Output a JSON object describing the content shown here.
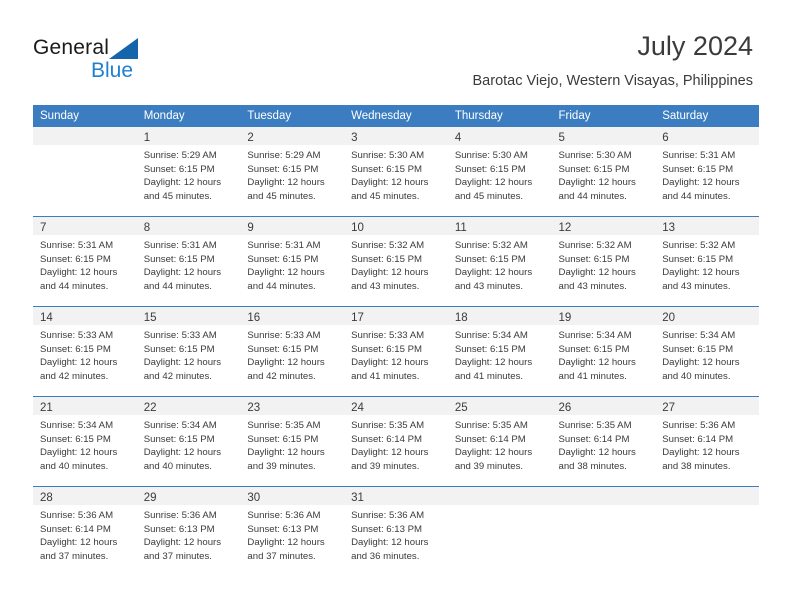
{
  "brand": {
    "name_part1": "General",
    "name_part2": "Blue",
    "accent_color": "#1f7fd0",
    "triangle_color": "#1565ab"
  },
  "header": {
    "title": "July 2024",
    "subtitle": "Barotac Viejo, Western Visayas, Philippines"
  },
  "calendar": {
    "header_bg": "#3b7dc0",
    "daynum_bg": "#f2f2f2",
    "weekday_headers": [
      "Sunday",
      "Monday",
      "Tuesday",
      "Wednesday",
      "Thursday",
      "Friday",
      "Saturday"
    ],
    "weeks": [
      [
        {
          "day": "",
          "sunrise": "",
          "sunset": "",
          "daylight_line1": "",
          "daylight_line2": ""
        },
        {
          "day": "1",
          "sunrise": "Sunrise: 5:29 AM",
          "sunset": "Sunset: 6:15 PM",
          "daylight_line1": "Daylight: 12 hours",
          "daylight_line2": "and 45 minutes."
        },
        {
          "day": "2",
          "sunrise": "Sunrise: 5:29 AM",
          "sunset": "Sunset: 6:15 PM",
          "daylight_line1": "Daylight: 12 hours",
          "daylight_line2": "and 45 minutes."
        },
        {
          "day": "3",
          "sunrise": "Sunrise: 5:30 AM",
          "sunset": "Sunset: 6:15 PM",
          "daylight_line1": "Daylight: 12 hours",
          "daylight_line2": "and 45 minutes."
        },
        {
          "day": "4",
          "sunrise": "Sunrise: 5:30 AM",
          "sunset": "Sunset: 6:15 PM",
          "daylight_line1": "Daylight: 12 hours",
          "daylight_line2": "and 45 minutes."
        },
        {
          "day": "5",
          "sunrise": "Sunrise: 5:30 AM",
          "sunset": "Sunset: 6:15 PM",
          "daylight_line1": "Daylight: 12 hours",
          "daylight_line2": "and 44 minutes."
        },
        {
          "day": "6",
          "sunrise": "Sunrise: 5:31 AM",
          "sunset": "Sunset: 6:15 PM",
          "daylight_line1": "Daylight: 12 hours",
          "daylight_line2": "and 44 minutes."
        }
      ],
      [
        {
          "day": "7",
          "sunrise": "Sunrise: 5:31 AM",
          "sunset": "Sunset: 6:15 PM",
          "daylight_line1": "Daylight: 12 hours",
          "daylight_line2": "and 44 minutes."
        },
        {
          "day": "8",
          "sunrise": "Sunrise: 5:31 AM",
          "sunset": "Sunset: 6:15 PM",
          "daylight_line1": "Daylight: 12 hours",
          "daylight_line2": "and 44 minutes."
        },
        {
          "day": "9",
          "sunrise": "Sunrise: 5:31 AM",
          "sunset": "Sunset: 6:15 PM",
          "daylight_line1": "Daylight: 12 hours",
          "daylight_line2": "and 44 minutes."
        },
        {
          "day": "10",
          "sunrise": "Sunrise: 5:32 AM",
          "sunset": "Sunset: 6:15 PM",
          "daylight_line1": "Daylight: 12 hours",
          "daylight_line2": "and 43 minutes."
        },
        {
          "day": "11",
          "sunrise": "Sunrise: 5:32 AM",
          "sunset": "Sunset: 6:15 PM",
          "daylight_line1": "Daylight: 12 hours",
          "daylight_line2": "and 43 minutes."
        },
        {
          "day": "12",
          "sunrise": "Sunrise: 5:32 AM",
          "sunset": "Sunset: 6:15 PM",
          "daylight_line1": "Daylight: 12 hours",
          "daylight_line2": "and 43 minutes."
        },
        {
          "day": "13",
          "sunrise": "Sunrise: 5:32 AM",
          "sunset": "Sunset: 6:15 PM",
          "daylight_line1": "Daylight: 12 hours",
          "daylight_line2": "and 43 minutes."
        }
      ],
      [
        {
          "day": "14",
          "sunrise": "Sunrise: 5:33 AM",
          "sunset": "Sunset: 6:15 PM",
          "daylight_line1": "Daylight: 12 hours",
          "daylight_line2": "and 42 minutes."
        },
        {
          "day": "15",
          "sunrise": "Sunrise: 5:33 AM",
          "sunset": "Sunset: 6:15 PM",
          "daylight_line1": "Daylight: 12 hours",
          "daylight_line2": "and 42 minutes."
        },
        {
          "day": "16",
          "sunrise": "Sunrise: 5:33 AM",
          "sunset": "Sunset: 6:15 PM",
          "daylight_line1": "Daylight: 12 hours",
          "daylight_line2": "and 42 minutes."
        },
        {
          "day": "17",
          "sunrise": "Sunrise: 5:33 AM",
          "sunset": "Sunset: 6:15 PM",
          "daylight_line1": "Daylight: 12 hours",
          "daylight_line2": "and 41 minutes."
        },
        {
          "day": "18",
          "sunrise": "Sunrise: 5:34 AM",
          "sunset": "Sunset: 6:15 PM",
          "daylight_line1": "Daylight: 12 hours",
          "daylight_line2": "and 41 minutes."
        },
        {
          "day": "19",
          "sunrise": "Sunrise: 5:34 AM",
          "sunset": "Sunset: 6:15 PM",
          "daylight_line1": "Daylight: 12 hours",
          "daylight_line2": "and 41 minutes."
        },
        {
          "day": "20",
          "sunrise": "Sunrise: 5:34 AM",
          "sunset": "Sunset: 6:15 PM",
          "daylight_line1": "Daylight: 12 hours",
          "daylight_line2": "and 40 minutes."
        }
      ],
      [
        {
          "day": "21",
          "sunrise": "Sunrise: 5:34 AM",
          "sunset": "Sunset: 6:15 PM",
          "daylight_line1": "Daylight: 12 hours",
          "daylight_line2": "and 40 minutes."
        },
        {
          "day": "22",
          "sunrise": "Sunrise: 5:34 AM",
          "sunset": "Sunset: 6:15 PM",
          "daylight_line1": "Daylight: 12 hours",
          "daylight_line2": "and 40 minutes."
        },
        {
          "day": "23",
          "sunrise": "Sunrise: 5:35 AM",
          "sunset": "Sunset: 6:15 PM",
          "daylight_line1": "Daylight: 12 hours",
          "daylight_line2": "and 39 minutes."
        },
        {
          "day": "24",
          "sunrise": "Sunrise: 5:35 AM",
          "sunset": "Sunset: 6:14 PM",
          "daylight_line1": "Daylight: 12 hours",
          "daylight_line2": "and 39 minutes."
        },
        {
          "day": "25",
          "sunrise": "Sunrise: 5:35 AM",
          "sunset": "Sunset: 6:14 PM",
          "daylight_line1": "Daylight: 12 hours",
          "daylight_line2": "and 39 minutes."
        },
        {
          "day": "26",
          "sunrise": "Sunrise: 5:35 AM",
          "sunset": "Sunset: 6:14 PM",
          "daylight_line1": "Daylight: 12 hours",
          "daylight_line2": "and 38 minutes."
        },
        {
          "day": "27",
          "sunrise": "Sunrise: 5:36 AM",
          "sunset": "Sunset: 6:14 PM",
          "daylight_line1": "Daylight: 12 hours",
          "daylight_line2": "and 38 minutes."
        }
      ],
      [
        {
          "day": "28",
          "sunrise": "Sunrise: 5:36 AM",
          "sunset": "Sunset: 6:14 PM",
          "daylight_line1": "Daylight: 12 hours",
          "daylight_line2": "and 37 minutes."
        },
        {
          "day": "29",
          "sunrise": "Sunrise: 5:36 AM",
          "sunset": "Sunset: 6:13 PM",
          "daylight_line1": "Daylight: 12 hours",
          "daylight_line2": "and 37 minutes."
        },
        {
          "day": "30",
          "sunrise": "Sunrise: 5:36 AM",
          "sunset": "Sunset: 6:13 PM",
          "daylight_line1": "Daylight: 12 hours",
          "daylight_line2": "and 37 minutes."
        },
        {
          "day": "31",
          "sunrise": "Sunrise: 5:36 AM",
          "sunset": "Sunset: 6:13 PM",
          "daylight_line1": "Daylight: 12 hours",
          "daylight_line2": "and 36 minutes."
        },
        {
          "day": "",
          "sunrise": "",
          "sunset": "",
          "daylight_line1": "",
          "daylight_line2": ""
        },
        {
          "day": "",
          "sunrise": "",
          "sunset": "",
          "daylight_line1": "",
          "daylight_line2": ""
        },
        {
          "day": "",
          "sunrise": "",
          "sunset": "",
          "daylight_line1": "",
          "daylight_line2": ""
        }
      ]
    ]
  }
}
